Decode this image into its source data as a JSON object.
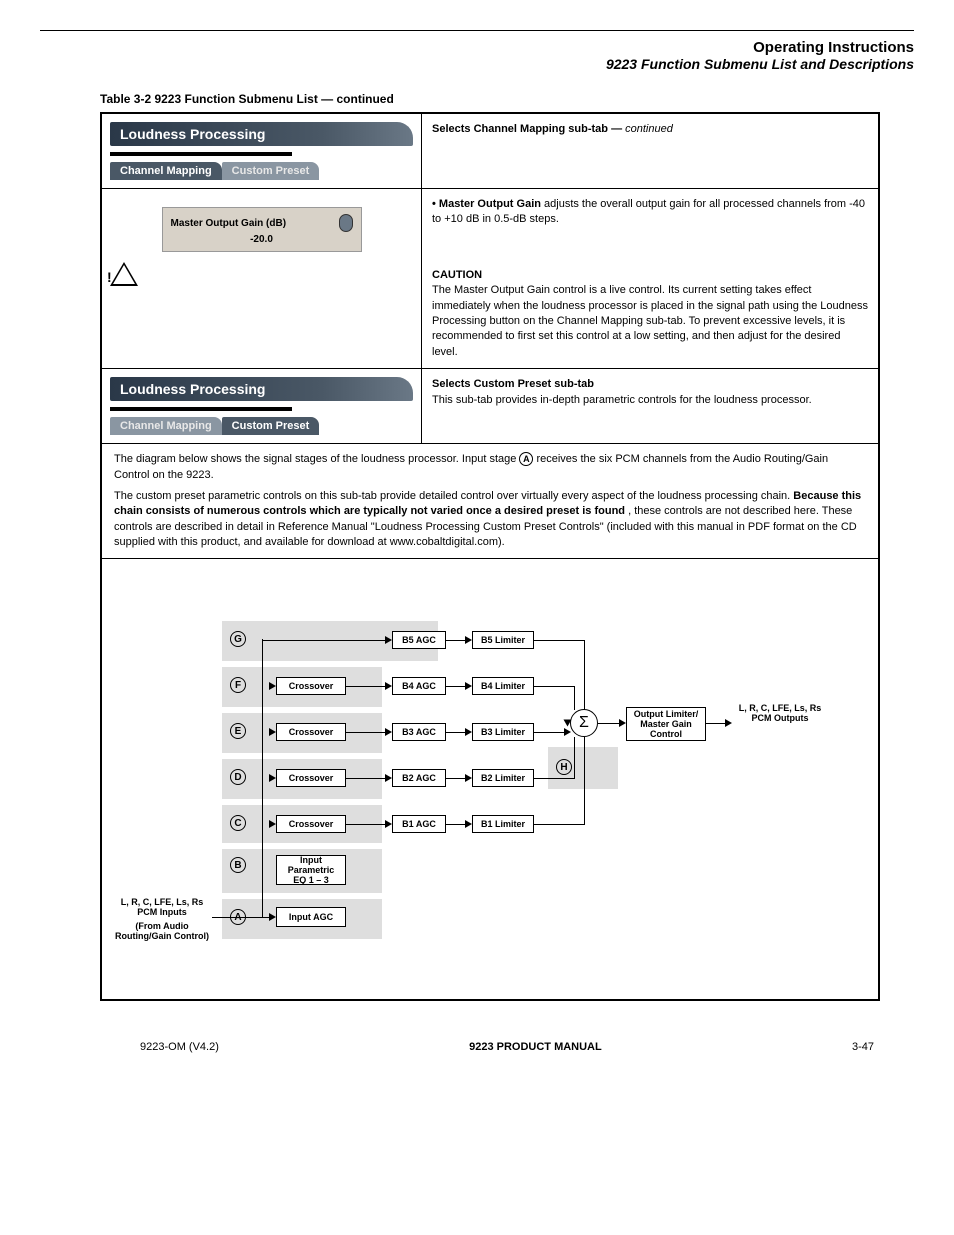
{
  "header": {
    "line1": "Operating Instructions",
    "line2": "9223 Function Submenu List and Descriptions"
  },
  "tableTitle": "Table 3-2   9223 Function Submenu List — continued",
  "sec1": {
    "lpTitle": "Loudness Processing",
    "tab1": "Channel Mapping",
    "tab2": "Custom Preset",
    "rightTitle": "Selects Channel Mapping sub-tab —",
    "rightText": "continued"
  },
  "gain": {
    "sliderLabel": "Master Output Gain (dB)",
    "sliderValue": "-20.0",
    "bullet": "• Master Output Gain",
    "desc": " adjusts the overall output gain for all processed channels from -40 to +10 dB in 0.5-dB steps.",
    "caution": "CAUTION",
    "cautionText": "The Master Output Gain control is a live control. Its current setting takes effect immediately when the loudness processor is placed in the signal path using the Loudness Processing button on the Channel Mapping sub-tab. To prevent excessive levels, it is recommended to first set this control at a low setting, and then adjust for the desired level."
  },
  "sec2": {
    "lpTitle": "Loudness Processing",
    "tab1": "Channel Mapping",
    "tab2": "Custom Preset",
    "rightTitle": "Selects Custom Preset sub-tab",
    "rightText": "This sub-tab provides in-depth parametric controls for the loudness processor."
  },
  "overview": {
    "lead": "The diagram below shows the signal stages of the loudness processor. Input stage ",
    "a": "A",
    "aText": " receives the six PCM channels from the Audio Routing/Gain Control on the 9223.",
    "part2a": "The custom preset parametric controls on this sub-tab provide detailed control over virtually every aspect of the loudness processing chain. ",
    "part2b": "Because this chain consists of numerous controls which are typically not varied once a desired preset is found",
    "part2c": ", these controls are not described here. These controls are described in detail in Reference Manual \"Loudness Processing Custom Preset Controls\" (included with this manual in PDF format on the CD supplied with this product, and available for download at www.cobaltdigital.com)."
  },
  "diagram": {
    "inLabel": "L, R, C, LFE, Ls, Rs PCM Inputs",
    "inSub": "(From Audio Routing/Gain Control)",
    "inputAGC": "Input AGC",
    "inputEQ": "Input Parametric EQ 1 – 3",
    "crossover": "Crossover",
    "b1a": "B1 AGC",
    "b1l": "B1 Limiter",
    "b2a": "B2 AGC",
    "b2l": "B2 Limiter",
    "b3a": "B3 AGC",
    "b3l": "B3 Limiter",
    "b4a": "B4 AGC",
    "b4l": "B4 Limiter",
    "b5a": "B5 AGC",
    "b5l": "B5 Limiter",
    "outBlock": "Output Limiter/ Master Gain Control",
    "outLabel": "L, R, C, LFE, Ls, Rs PCM Outputs",
    "markers": {
      "A": "A",
      "B": "B",
      "C": "C",
      "D": "D",
      "E": "E",
      "F": "F",
      "G": "G",
      "H": "H"
    },
    "sigma": "Σ"
  },
  "footer": {
    "left": "9223-OM (V4.2)",
    "mid": "9223 PRODUCT MANUAL",
    "right": "3-47"
  }
}
